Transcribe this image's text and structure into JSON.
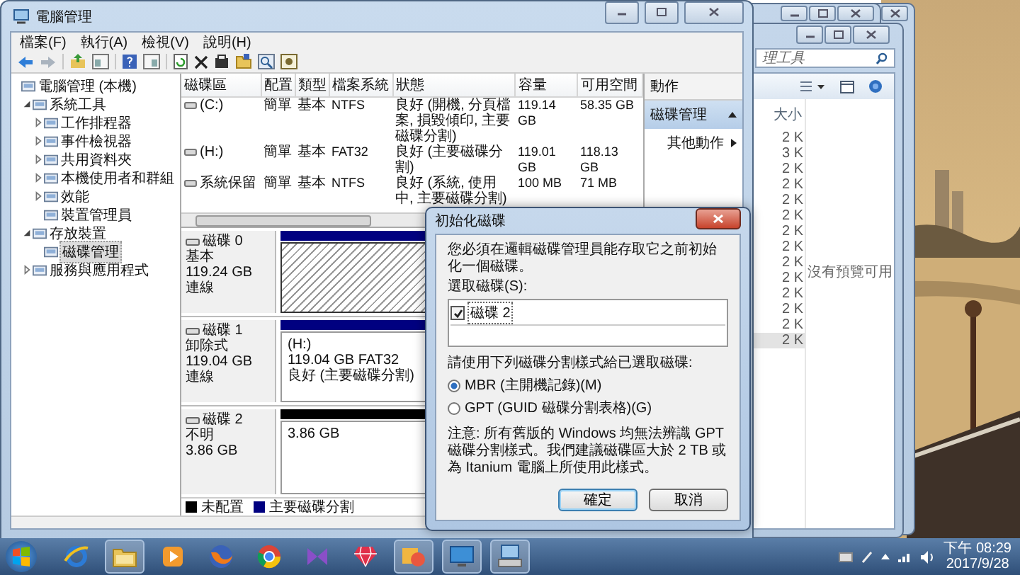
{
  "background_windows": {
    "explorer": {
      "address": "理工具",
      "size_header": "大小",
      "preview": "沒有預覽可用",
      "sizes": [
        {
          "text": "2 K",
          "selected": false
        },
        {
          "text": "3 K",
          "selected": false
        },
        {
          "text": "2 K",
          "selected": false
        },
        {
          "text": "2 K",
          "selected": false
        },
        {
          "text": "2 K",
          "selected": false
        },
        {
          "text": "2 K",
          "selected": false
        },
        {
          "text": "2 K",
          "selected": false
        },
        {
          "text": "2 K",
          "selected": false
        },
        {
          "text": "2 K",
          "selected": false
        },
        {
          "text": "2 K",
          "selected": false
        },
        {
          "text": "2 K",
          "selected": false
        },
        {
          "text": "2 K",
          "selected": false
        },
        {
          "text": "2 K",
          "selected": false
        },
        {
          "text": "2 K",
          "selected": true
        }
      ]
    }
  },
  "window": {
    "title": "電腦管理",
    "menu": [
      "檔案(F)",
      "執行(A)",
      "檢視(V)",
      "說明(H)"
    ],
    "tree": [
      {
        "label": "電腦管理 (本機)",
        "selected": false,
        "children": [
          {
            "label": "系統工具",
            "expanded": true,
            "selected": false,
            "children": [
              {
                "label": "工作排程器",
                "expanded": false,
                "selected": false
              },
              {
                "label": "事件檢視器",
                "expanded": false,
                "selected": false
              },
              {
                "label": "共用資料夾",
                "expanded": false,
                "selected": false
              },
              {
                "label": "本機使用者和群組",
                "expanded": false,
                "selected": false
              },
              {
                "label": "效能",
                "expanded": false,
                "selected": false
              },
              {
                "label": "裝置管理員",
                "selected": false
              }
            ]
          },
          {
            "label": "存放裝置",
            "expanded": true,
            "selected": false,
            "children": [
              {
                "label": "磁碟管理",
                "selected": true
              }
            ]
          },
          {
            "label": "服務與應用程式",
            "expanded": false,
            "selected": false
          }
        ]
      }
    ],
    "table": {
      "columns": [
        "磁碟區",
        "配置",
        "類型",
        "檔案系統",
        "狀態",
        "容量",
        "可用空間"
      ],
      "rows": [
        [
          "(C:)",
          "簡單",
          "基本",
          "NTFS",
          "良好 (開機, 分頁檔案, 損毀傾印, 主要磁碟分割)",
          "119.14 GB",
          "58.35 GB"
        ],
        [
          "(H:)",
          "簡單",
          "基本",
          "FAT32",
          "良好 (主要磁碟分割)",
          "119.01 GB",
          "118.13 GB"
        ],
        [
          "系統保留",
          "簡單",
          "基本",
          "NTFS",
          "良好 (系統, 使用中, 主要磁碟分割)",
          "100 MB",
          "71 MB"
        ]
      ]
    },
    "actions": [
      {
        "label": "動作",
        "kind": "title"
      },
      {
        "label": "磁碟管理",
        "kind": "section"
      },
      {
        "label": "其他動作",
        "kind": "item"
      }
    ],
    "disks": [
      {
        "lines": [
          "磁碟 0",
          "基本",
          "119.24 GB",
          "連線"
        ],
        "partitions": [
          {
            "kind": "primary",
            "selected": true
          }
        ]
      },
      {
        "lines": [
          "磁碟 1",
          "卸除式",
          "119.04 GB",
          "連線"
        ],
        "partitions": [
          {
            "kind": "primary",
            "selected": false,
            "lines": [
              "(H:)",
              "119.04 GB FAT32",
              "良好 (主要磁碟分割)"
            ]
          }
        ]
      },
      {
        "lines": [
          "磁碟 2",
          "不明",
          "3.86 GB"
        ],
        "partitions": [
          {
            "kind": "unallocated",
            "selected": false,
            "lines": [
              "3.86 GB"
            ]
          }
        ]
      }
    ],
    "legend": [
      {
        "label": "未配置",
        "color": "#000000"
      },
      {
        "label": "主要磁碟分割",
        "color": "#000080"
      }
    ]
  },
  "dialog": {
    "title": "初始化磁碟",
    "intro": "您必須在邏輯磁碟管理員能存取它之前初始化一個磁碟。",
    "select_label": "選取磁碟(S):",
    "disks": [
      {
        "label": "磁碟 2",
        "checked": true
      }
    ],
    "style_label": "請使用下列磁碟分割樣式給已選取磁碟:",
    "options": [
      {
        "label": "MBR (主開機記錄)(M)",
        "selected": true
      },
      {
        "label": "GPT (GUID 磁碟分割表格)(G)",
        "selected": false
      }
    ],
    "note": "注意: 所有舊版的 Windows 均無法辨識 GPT 磁碟分割樣式。我們建議磁碟區大於 2 TB 或為 Itanium 電腦上所使用此樣式。",
    "buttons": [
      {
        "label": "確定",
        "default": true
      },
      {
        "label": "取消",
        "default": false
      }
    ]
  },
  "taskbar": {
    "apps": [
      {
        "open": false
      },
      {
        "open": true
      },
      {
        "open": false
      },
      {
        "open": false
      },
      {
        "open": false
      },
      {
        "open": false
      },
      {
        "open": false
      },
      {
        "open": true
      },
      {
        "open": true
      },
      {
        "open": true
      }
    ],
    "time": "下午 08:29",
    "date": "2017/9/28"
  }
}
